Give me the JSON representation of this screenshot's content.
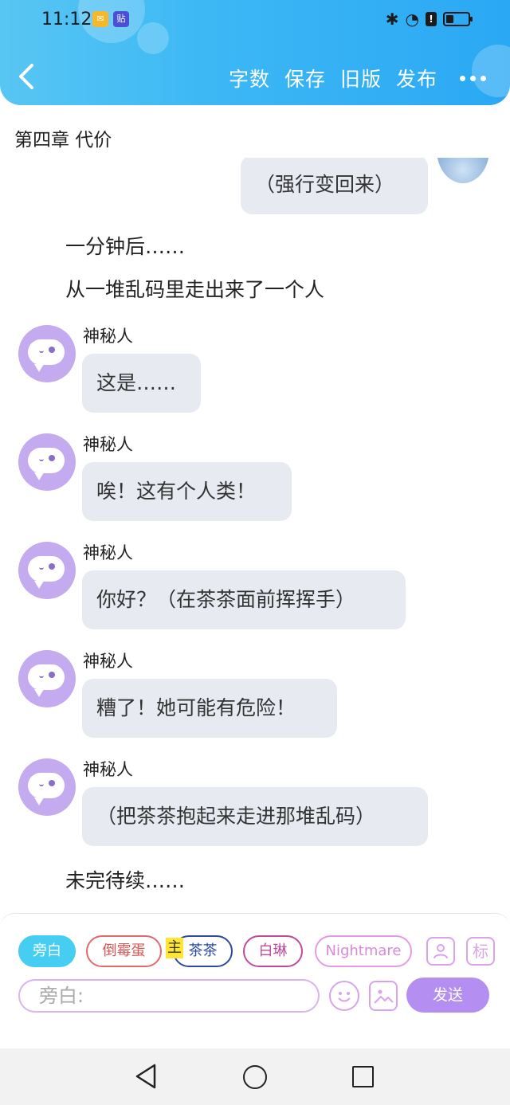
{
  "status_bar": {
    "time": "11:12",
    "app_icon_1": "mail-icon",
    "app_icon_2_text": "贴"
  },
  "header": {
    "actions": [
      "字数",
      "保存",
      "旧版",
      "发布"
    ]
  },
  "chapter_title": "第四章 代价",
  "messages": {
    "right_bubble": "（强行变回来）",
    "narration_1": "一分钟后……",
    "narration_2": "从一堆乱码里走出来了一个人",
    "speaker": "神秘人",
    "m1": "这是……",
    "m2": "唉！这有个人类！",
    "m3": "你好？（在茶茶面前挥挥手）",
    "m4": "糟了！她可能有危险！",
    "m5": "（把茶茶抱起来走进那堆乱码）",
    "narration_3": "未完待续……"
  },
  "composer": {
    "chips": [
      "旁白",
      "倒霉蛋",
      "茶茶",
      "白琳",
      "Nightmare"
    ],
    "main_tag": "主",
    "tag_icon_label": "标",
    "input_placeholder": "旁白:",
    "send_label": "发送"
  },
  "colors": {
    "header": "#3db8f5",
    "active_chip": "#45cdf2",
    "send": "#b48ef0",
    "bubble": "#e7ebf1",
    "avatar": "#c4abf0"
  }
}
